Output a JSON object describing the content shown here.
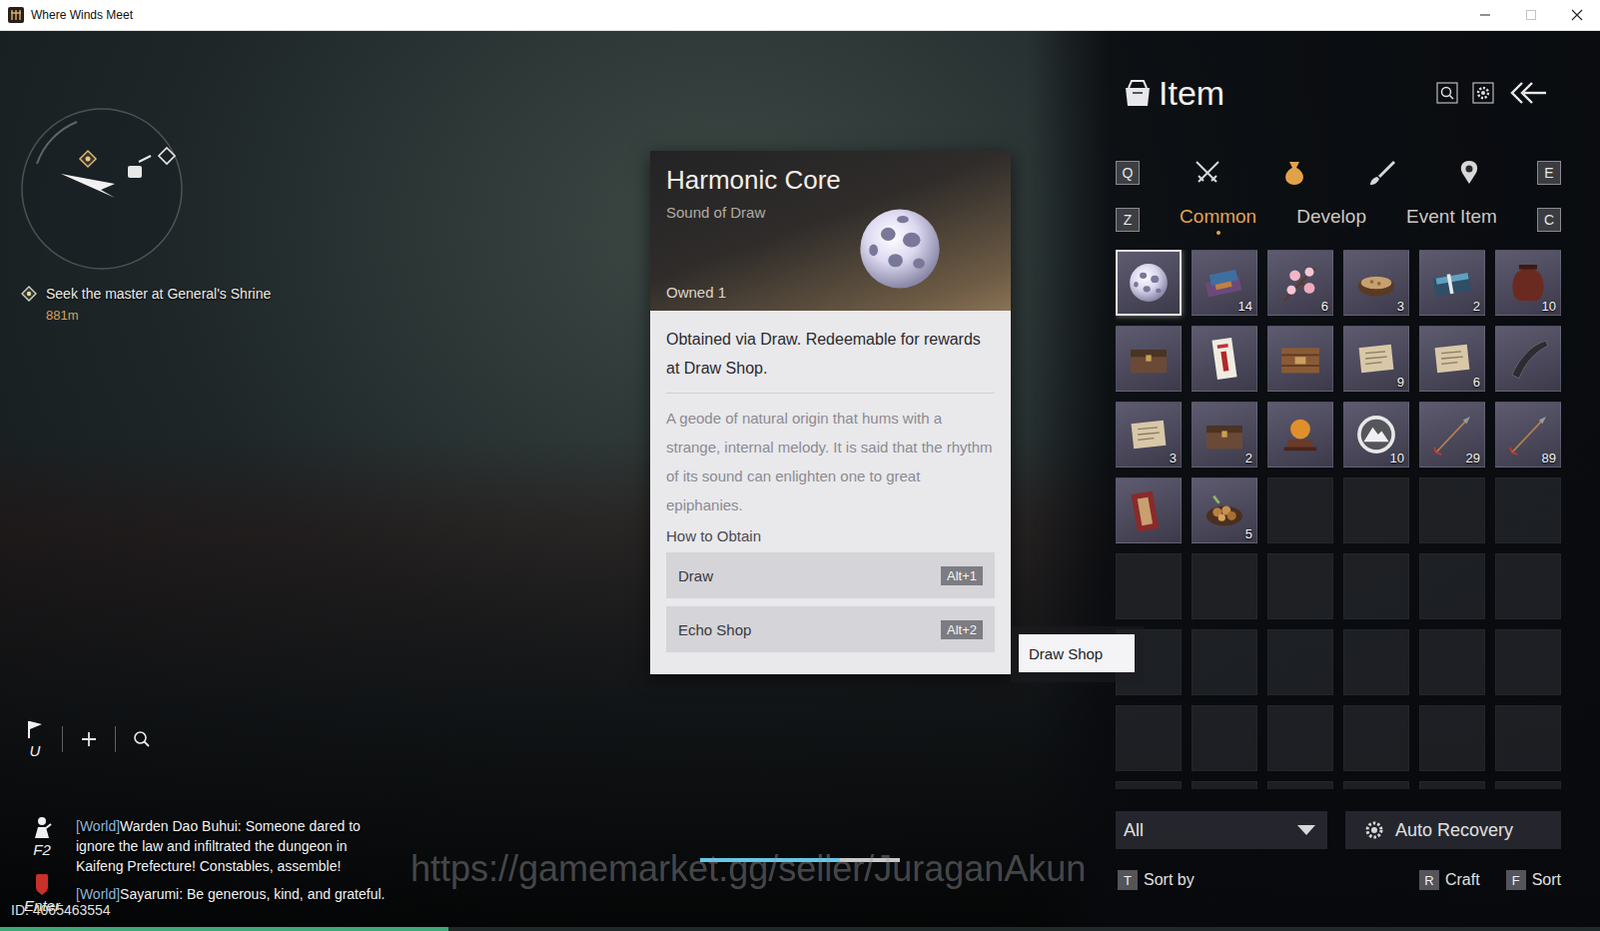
{
  "window": {
    "title": "Where Winds Meet",
    "maximize_disabled": true
  },
  "quest": {
    "text": "Seek the master at General's Shrine",
    "distance": "881m"
  },
  "hud_keys": {
    "flag": "U",
    "social": "F2",
    "chat": "Enter"
  },
  "chat": [
    {
      "channel": "[World]",
      "message": "Warden Dao Buhui: Someone dared to ignore the law and infiltrated the dungeon in Kaifeng Prefecture! Constables, assemble!"
    },
    {
      "channel": "[World]",
      "message": "Sayarumi: Be generous, kind, and grateful."
    }
  ],
  "player_id": "ID: 4065463554",
  "exp_bar": {
    "level": 0.28
  },
  "cast_bar": {
    "level": 0.7
  },
  "watermark": "https://gamemarket.gg/seller/JuraganAkun",
  "tooltip": {
    "title": "Harmonic Core",
    "subtitle": "Sound of Draw",
    "owned": "Owned 1",
    "description": "Obtained via Draw. Redeemable for rewards at Draw Shop.",
    "lore": "A geode of natural origin that hums with a strange, internal melody. It is said that the rhythm of its sound can enlighten one to great epiphanies.",
    "how_to_obtain": "How to Obtain",
    "sources": [
      {
        "label": "Draw",
        "key": "Alt+1"
      },
      {
        "label": "Echo Shop",
        "key": "Alt+2"
      }
    ]
  },
  "context_button": "Draw Shop",
  "panel": {
    "title": "Item",
    "prev_key": "Q",
    "next_key": "E",
    "tabs": [
      {
        "kind": "swords",
        "selected": false
      },
      {
        "kind": "pouch",
        "selected": true
      },
      {
        "kind": "brush",
        "selected": false
      },
      {
        "kind": "pin",
        "selected": false
      }
    ],
    "subtab_prev_key": "Z",
    "subtab_next_key": "C",
    "subtabs": [
      {
        "label": "Common",
        "selected": true
      },
      {
        "label": "Develop",
        "selected": false
      },
      {
        "label": "Event Item",
        "selected": false
      }
    ],
    "slots": [
      {
        "kind": "orb",
        "selected": true
      },
      {
        "kind": "bundle",
        "count": "14",
        "selected": false
      },
      {
        "kind": "blossom",
        "count": "6",
        "selected": false
      },
      {
        "kind": "bowl",
        "count": "3",
        "selected": false
      },
      {
        "kind": "case",
        "count": "2",
        "selected": false
      },
      {
        "kind": "jar",
        "count": "10",
        "selected": false
      },
      {
        "kind": "chest",
        "selected": false
      },
      {
        "kind": "talisman",
        "selected": false
      },
      {
        "kind": "crate",
        "selected": false
      },
      {
        "kind": "letter",
        "count": "9",
        "selected": false
      },
      {
        "kind": "letter",
        "count": "6",
        "selected": false
      },
      {
        "kind": "horn",
        "selected": false
      },
      {
        "kind": "letter",
        "count": "3",
        "selected": false
      },
      {
        "kind": "chest",
        "count": "2",
        "selected": false
      },
      {
        "kind": "ball",
        "selected": false
      },
      {
        "kind": "emblem",
        "count": "10",
        "selected": false
      },
      {
        "kind": "arrow",
        "count": "29",
        "selected": false
      },
      {
        "kind": "arrow",
        "count": "89",
        "selected": false
      },
      {
        "kind": "plaque",
        "selected": false
      },
      {
        "kind": "food",
        "count": "5",
        "selected": false
      },
      {
        "kind": "empty",
        "selected": false
      },
      {
        "kind": "empty",
        "selected": false
      },
      {
        "kind": "empty",
        "selected": false
      },
      {
        "kind": "empty",
        "selected": false
      },
      {
        "kind": "empty",
        "selected": false
      },
      {
        "kind": "empty",
        "selected": false
      },
      {
        "kind": "empty",
        "selected": false
      },
      {
        "kind": "empty",
        "selected": false
      },
      {
        "kind": "empty",
        "selected": false
      },
      {
        "kind": "empty",
        "selected": false
      },
      {
        "kind": "empty",
        "selected": false
      },
      {
        "kind": "empty",
        "selected": false
      },
      {
        "kind": "empty",
        "selected": false
      },
      {
        "kind": "empty",
        "selected": false
      },
      {
        "kind": "empty",
        "selected": false
      },
      {
        "kind": "empty",
        "selected": false
      },
      {
        "kind": "empty",
        "selected": false
      },
      {
        "kind": "empty",
        "selected": false
      },
      {
        "kind": "empty",
        "selected": false
      },
      {
        "kind": "empty",
        "selected": false
      },
      {
        "kind": "empty",
        "selected": false
      },
      {
        "kind": "empty",
        "selected": false
      },
      {
        "kind": "empty",
        "selected": false
      },
      {
        "kind": "empty",
        "selected": false
      },
      {
        "kind": "empty",
        "selected": false
      },
      {
        "kind": "empty",
        "selected": false
      },
      {
        "kind": "empty",
        "selected": false
      },
      {
        "kind": "empty",
        "selected": false
      }
    ],
    "filter": "All",
    "auto_recovery": "Auto Recovery",
    "actions": [
      {
        "key": "T",
        "label": "Sort by"
      },
      {
        "key": "R",
        "label": "Craft"
      },
      {
        "key": "F",
        "label": "Sort"
      }
    ]
  }
}
